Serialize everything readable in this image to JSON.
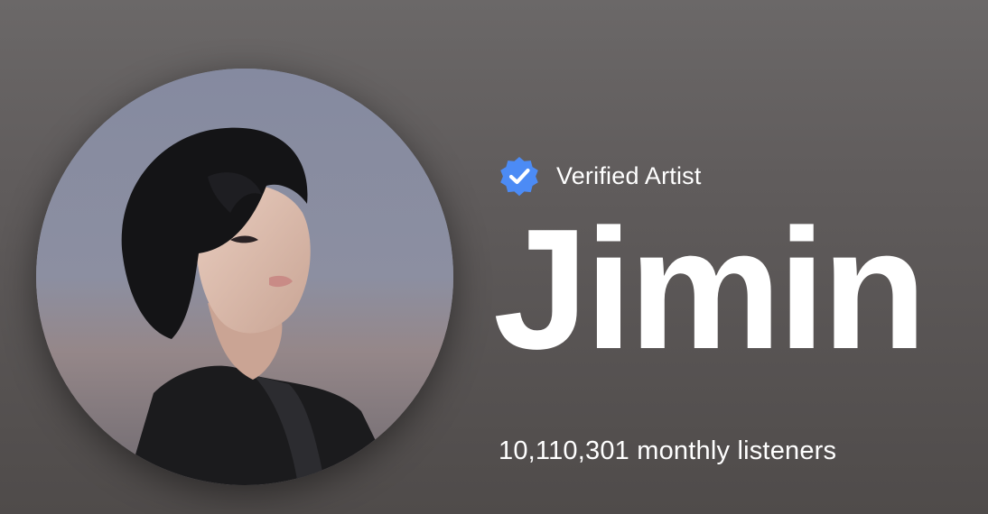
{
  "artist": {
    "verified_label": "Verified Artist",
    "name": "Jimin",
    "monthly_listeners": "10,110,301 monthly listeners",
    "avatar_icon": "artist-photo",
    "verified_icon": "verified-badge-icon"
  },
  "colors": {
    "background": "#605c5c",
    "verified_badge": "#4c8bf5",
    "text": "#ffffff"
  }
}
